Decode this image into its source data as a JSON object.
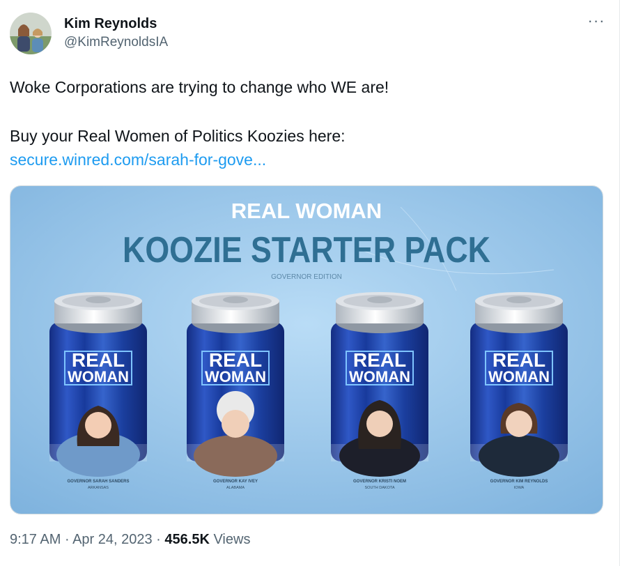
{
  "author": {
    "name": "Kim Reynolds",
    "handle": "@KimReynoldsIA"
  },
  "menu": {
    "more_icon": "more-horizontal-icon",
    "label": "···"
  },
  "tweet": {
    "line1": "Woke Corporations are trying to change who WE are!",
    "line2": "Buy your Real Women of Politics Koozies here:",
    "link": "secure.winred.com/sarah-for-gove..."
  },
  "image": {
    "headline": "REAL WOMAN",
    "title": "KOOZIE STARTER PACK",
    "subtitle": "GOVERNOR EDITION",
    "can_label_top": "REAL",
    "can_label_bottom": "WOMAN",
    "cans": [
      {
        "caption": "GOVERNOR SARAH SANDERS",
        "state": "ARKANSAS"
      },
      {
        "caption": "GOVERNOR KAY IVEY",
        "state": "ALABAMA"
      },
      {
        "caption": "GOVERNOR KRISTI NOEM",
        "state": "SOUTH DAKOTA"
      },
      {
        "caption": "GOVERNOR KIM REYNOLDS",
        "state": "IOWA"
      }
    ]
  },
  "footer": {
    "time": "9:17 AM",
    "date": "Apr 24, 2023",
    "views_count": "456.5K",
    "views_label": "Views"
  },
  "colors": {
    "link": "#1d9bf0",
    "secondary_text": "#536471",
    "image_bg": "#9bc6ea",
    "title_blue": "#2f6f93"
  }
}
